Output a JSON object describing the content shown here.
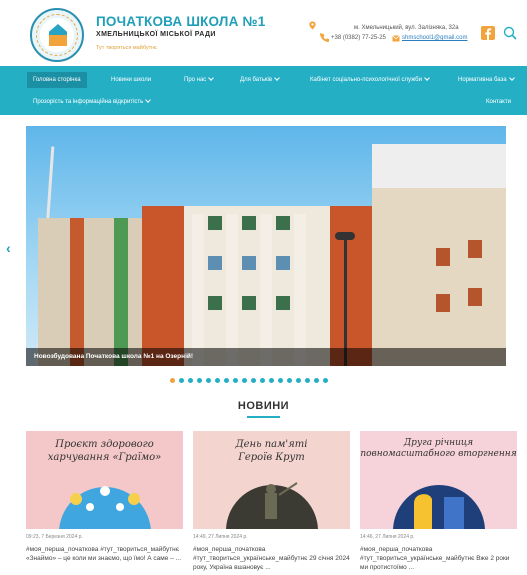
{
  "header": {
    "title": "ПОЧАТКОВА ШКОЛА №1",
    "subtitle": "ХМЕЛЬНИЦЬКОЇ МІСЬКОЇ РАДИ",
    "motto": "Тут творяться майбутнє",
    "address": "м. Хмельницький, вул. Залізняка, 32а",
    "phone": "+38 (0382) 77-25-25",
    "email": "shmschool1@gmail.com",
    "icons": [
      "map-pin-icon",
      "phone-icon",
      "mail-icon",
      "facebook-icon",
      "search-icon"
    ],
    "accent_color": "#25afc5",
    "secondary_color": "#f2a33a"
  },
  "nav": {
    "items": [
      {
        "label": "Головна сторінка",
        "active": true,
        "dropdown": false
      },
      {
        "label": "Новини школи",
        "active": false,
        "dropdown": false
      },
      {
        "label": "Про нас",
        "active": false,
        "dropdown": true
      },
      {
        "label": "Для батьків",
        "active": false,
        "dropdown": true
      },
      {
        "label": "Кабінет соціально-психологічної служби",
        "active": false,
        "dropdown": true
      },
      {
        "label": "Нормативна база",
        "active": false,
        "dropdown": true
      },
      {
        "label": "Прозорість та інформаційна відкритість",
        "active": false,
        "dropdown": true
      },
      {
        "label": "Контакти",
        "active": false,
        "dropdown": false
      }
    ]
  },
  "slider": {
    "caption": "Новозбудована Початкова школа №1 на Озерній!",
    "dot_count": 18,
    "active_dot": 0,
    "prev_arrow": "‹"
  },
  "news": {
    "heading": "НОВИНИ",
    "cards": [
      {
        "image_title_line1": "Проєкт здорового",
        "image_title_line2": "харчування «Граїмо»",
        "date": "09:23, 7 Березня 2024 р.",
        "text": "#моя_перша_початкова #тут_твориться_майбутнє «Знаймо» – це коли ми знаємо, що їмо! А саме – ..."
      },
      {
        "image_title_line1": "День пам'яті",
        "image_title_line2": "Героїв Крут",
        "date": "14:49, 27 Липня 2024 р.",
        "text": "#моя_перша_початкова #тут_твориться_українське_майбутнє 29 січня 2024 року, Україна вшановує ..."
      },
      {
        "image_title_line1": "Друга річниця",
        "image_title_line2": "повномасштабного вторгнення",
        "date": "14:46, 27 Липня 2024 р.",
        "text": "#моя_перша_початкова #тут_твориться_українське_майбутнє Вже 2 роки ми протистоїмо ..."
      }
    ]
  }
}
